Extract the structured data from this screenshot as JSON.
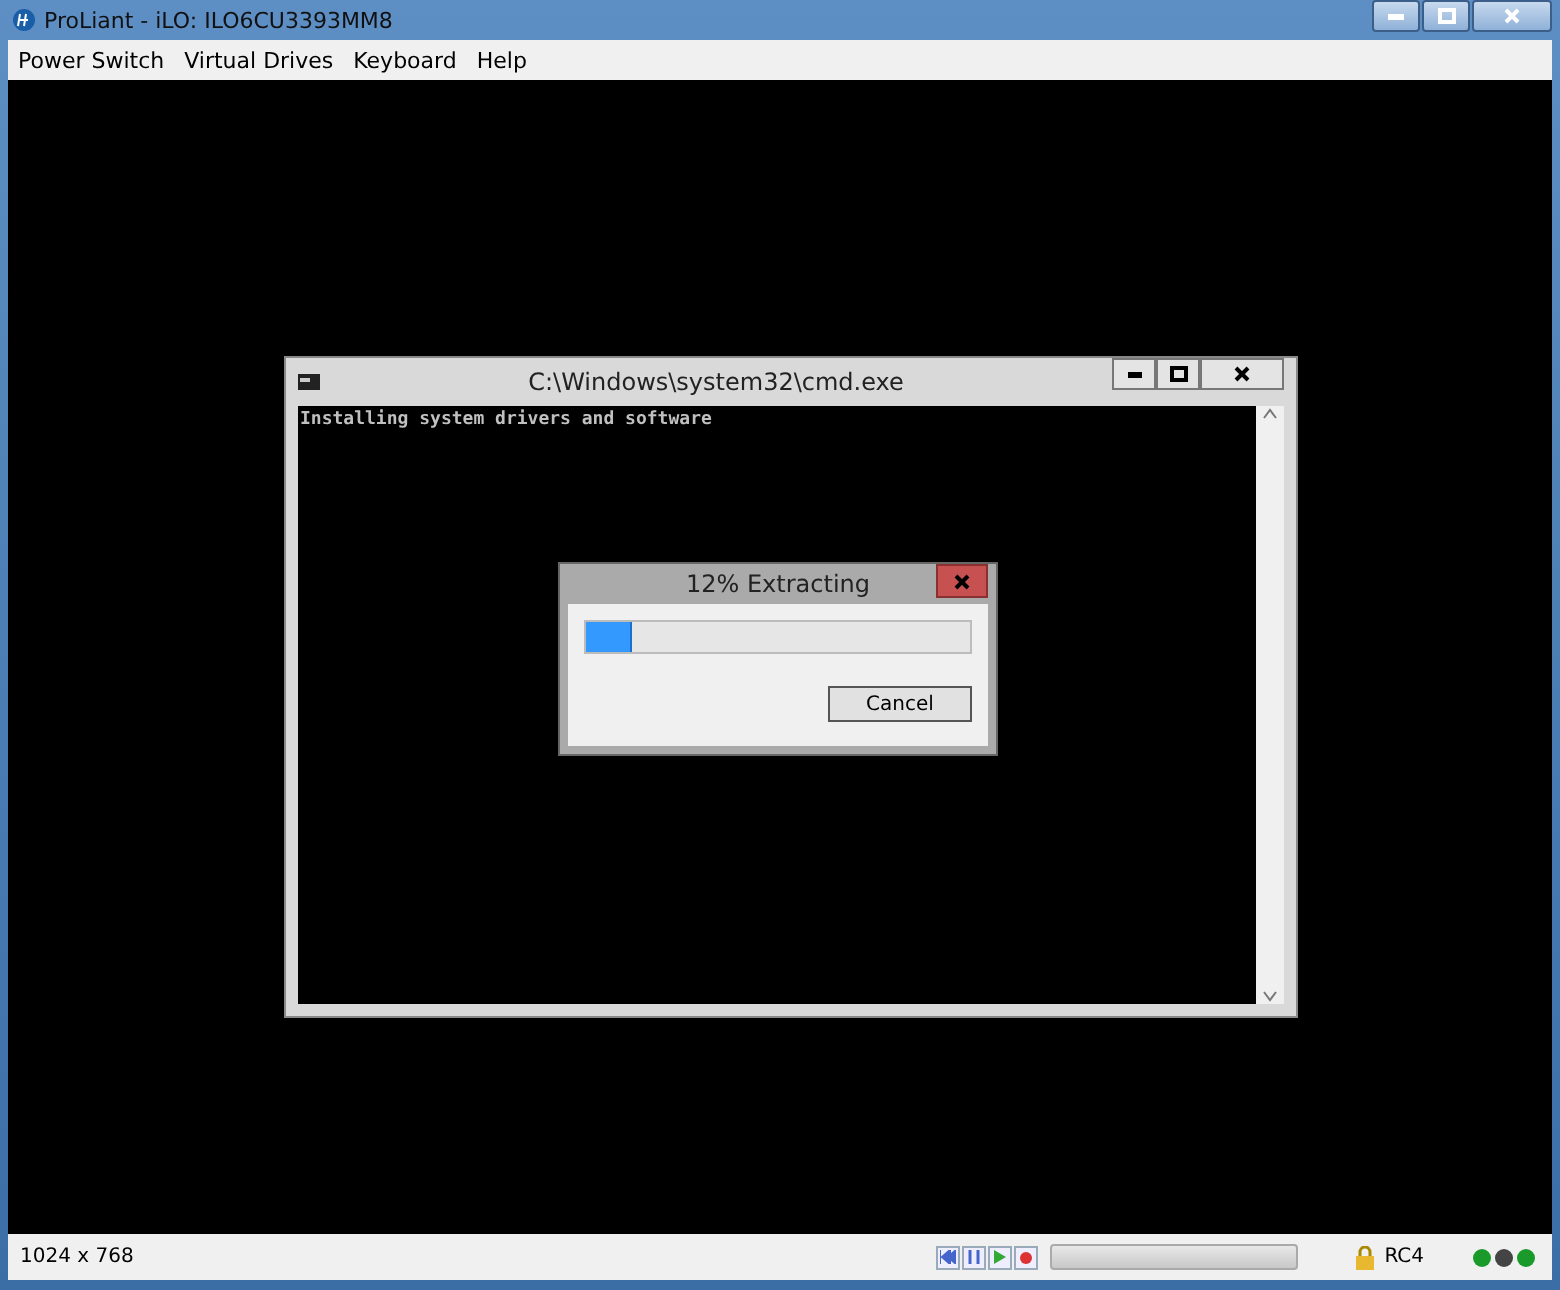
{
  "window": {
    "title": "ProLiant - iLO: ILO6CU3393MM8"
  },
  "menu": [
    "Power Switch",
    "Virtual Drives",
    "Keyboard",
    "Help"
  ],
  "console_window": {
    "title": "C:\\Windows\\system32\\cmd.exe",
    "lines": [
      "Installing system drivers and software"
    ]
  },
  "progress_dialog": {
    "title": "12% Extracting",
    "level": 0.12,
    "buttons": [
      "Cancel"
    ]
  },
  "status_bar": {
    "resolution": "1024 x 768",
    "encryption": "RC4"
  }
}
